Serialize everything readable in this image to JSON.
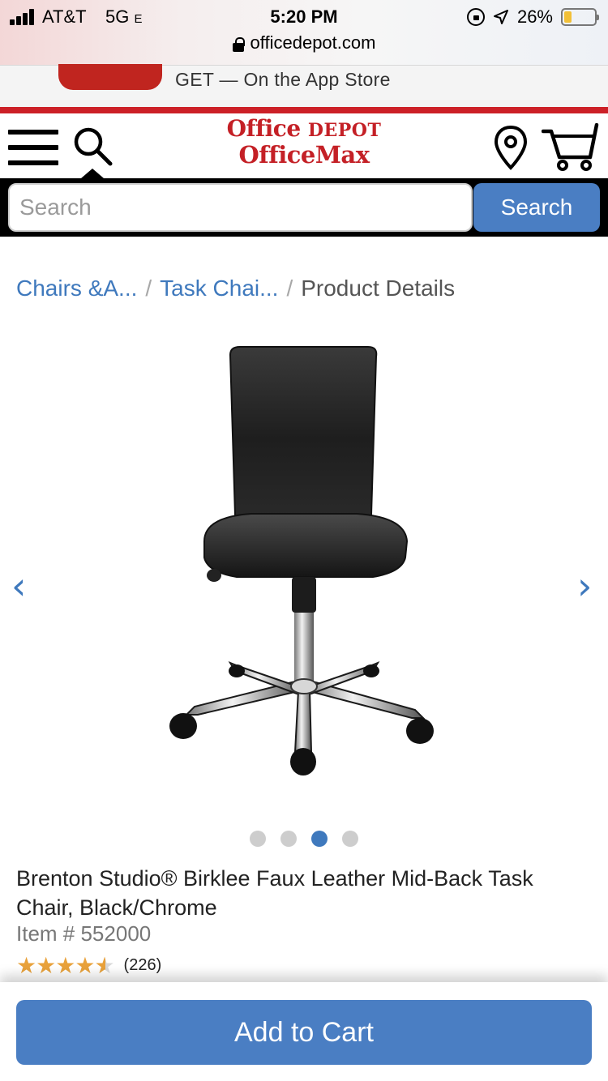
{
  "status_bar": {
    "carrier": "AT&T",
    "network": "5G",
    "network_suffix": "E",
    "time": "5:20 PM",
    "battery_percent": "26%",
    "battery_level": 0.26
  },
  "browser": {
    "url": "officedepot.com"
  },
  "app_banner": {
    "text": "GET — On the App Store"
  },
  "header": {
    "logo_line1_a": "Office",
    "logo_line1_b": "DEPOT",
    "logo_line2": "OfficeMax",
    "icons": [
      "menu-icon",
      "search-icon",
      "location-pin-icon",
      "cart-icon"
    ]
  },
  "search": {
    "placeholder": "Search",
    "value": "",
    "button_label": "Search"
  },
  "breadcrumb": {
    "items": [
      "Chairs &A...",
      "Task Chai...",
      "Product Details"
    ],
    "separator": "/"
  },
  "carousel": {
    "prev_label": "‹",
    "next_label": "›",
    "image_count": 4,
    "active_index": 2
  },
  "product": {
    "title": "Brenton Studio® Birklee Faux Leather Mid-Back Task Chair, Black/Chrome",
    "item_number": "Item # 552000",
    "rating": 4.5,
    "review_count": "(226)"
  },
  "actions": {
    "add_to_cart_label": "Add to Cart"
  },
  "colors": {
    "brand_red": "#cc2027",
    "link_blue": "#3f79bd",
    "button_blue": "#4a7ec3",
    "star_gold": "#e9a23b"
  }
}
